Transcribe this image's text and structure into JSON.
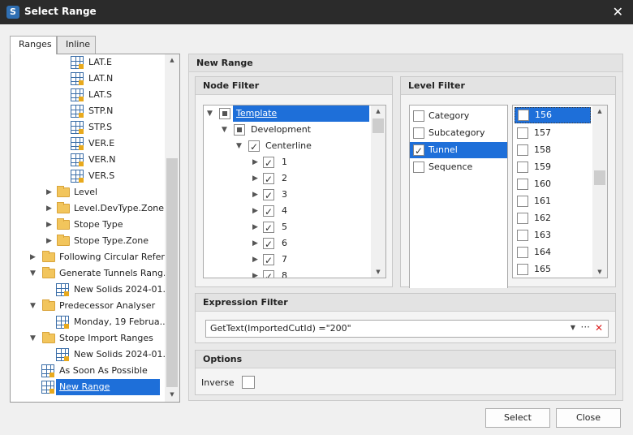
{
  "window": {
    "title": "Select Range"
  },
  "tabs": [
    "Ranges",
    "Inline"
  ],
  "tree": [
    {
      "label": "LAT.E",
      "type": "range"
    },
    {
      "label": "LAT.N",
      "type": "range"
    },
    {
      "label": "LAT.S",
      "type": "range"
    },
    {
      "label": "STP.N",
      "type": "range"
    },
    {
      "label": "STP.S",
      "type": "range"
    },
    {
      "label": "VER.E",
      "type": "range"
    },
    {
      "label": "VER.N",
      "type": "range"
    },
    {
      "label": "VER.S",
      "type": "range"
    },
    {
      "label": "Level",
      "type": "folder"
    },
    {
      "label": "Level.DevType.Zone",
      "type": "folder"
    },
    {
      "label": "Stope Type",
      "type": "folder"
    },
    {
      "label": "Stope Type.Zone",
      "type": "folder"
    },
    {
      "label": "Following Circular Refer...",
      "type": "folder"
    },
    {
      "label": "Generate Tunnels Rang...",
      "type": "folder-open"
    },
    {
      "label": "New Solids 2024-01...",
      "type": "range"
    },
    {
      "label": "Predecessor Analyser",
      "type": "folder-open"
    },
    {
      "label": "Monday, 19 Februa...",
      "type": "range"
    },
    {
      "label": "Stope Import Ranges",
      "type": "folder-open"
    },
    {
      "label": "New Solids 2024-01...",
      "type": "range"
    },
    {
      "label": "As Soon As Possible",
      "type": "range"
    },
    {
      "label": "New Range",
      "type": "range",
      "selected": true
    }
  ],
  "new_range": {
    "title": "New Range",
    "node_filter": {
      "title": "Node Filter",
      "nodes": [
        {
          "label": "Template",
          "state": "partial",
          "selected": true
        },
        {
          "label": "Development",
          "state": "partial"
        },
        {
          "label": "Centerline",
          "state": "checked"
        },
        {
          "label": "1",
          "state": "checked"
        },
        {
          "label": "2",
          "state": "checked"
        },
        {
          "label": "3",
          "state": "checked"
        },
        {
          "label": "4",
          "state": "checked"
        },
        {
          "label": "5",
          "state": "checked"
        },
        {
          "label": "6",
          "state": "checked"
        },
        {
          "label": "7",
          "state": "checked"
        },
        {
          "label": "8",
          "state": "checked"
        }
      ]
    },
    "level_filter": {
      "title": "Level Filter",
      "categories": [
        {
          "label": "Category",
          "checked": false
        },
        {
          "label": "Subcategory",
          "checked": false
        },
        {
          "label": "Tunnel",
          "checked": true,
          "selected": true
        },
        {
          "label": "Sequence",
          "checked": false
        }
      ],
      "values": [
        "156",
        "157",
        "158",
        "159",
        "160",
        "161",
        "162",
        "163",
        "164",
        "165"
      ]
    },
    "expression_filter": {
      "title": "Expression Filter",
      "value": "GetText(ImportedCutId) =\"200\""
    },
    "options": {
      "title": "Options",
      "inverse_label": "Inverse"
    }
  },
  "buttons": {
    "select": "Select",
    "close": "Close"
  }
}
